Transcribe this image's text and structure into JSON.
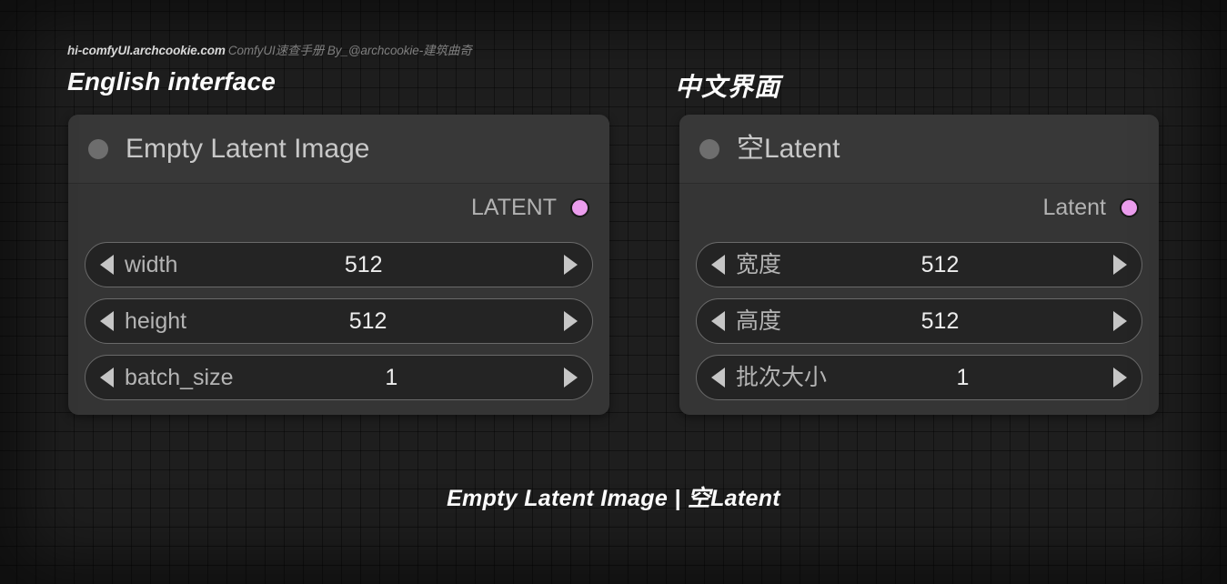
{
  "header": {
    "site": "hi-comfyUI.archcookie.com",
    "subtitle": "ComfyUI速查手册  By_@archcookie-建筑曲奇"
  },
  "sections": {
    "english_title": "English interface",
    "chinese_title": "中文界面"
  },
  "colors": {
    "latent_dot": "#eb9ded",
    "node_body": "#353535",
    "node_header": "#383838",
    "widget_fill": "#242424",
    "widget_border": "#6a6a6a"
  },
  "nodes": [
    {
      "id": "empty-latent-image-en",
      "title": "Empty Latent Image",
      "collapse_icon": "collapse-dot-icon",
      "output": {
        "label": "LATENT",
        "dot_icon": "latent-output-dot-icon"
      },
      "widgets": [
        {
          "name": "width",
          "label": "width",
          "value": "512"
        },
        {
          "name": "height",
          "label": "height",
          "value": "512"
        },
        {
          "name": "batch_size",
          "label": "batch_size",
          "value": "1"
        }
      ]
    },
    {
      "id": "empty-latent-image-zh",
      "title": "空Latent",
      "collapse_icon": "collapse-dot-icon",
      "output": {
        "label": "Latent",
        "dot_icon": "latent-output-dot-icon"
      },
      "widgets": [
        {
          "name": "width",
          "label": "宽度",
          "value": "512"
        },
        {
          "name": "height",
          "label": "高度",
          "value": "512"
        },
        {
          "name": "batch_size",
          "label": "批次大小",
          "value": "1"
        }
      ]
    }
  ],
  "caption": "Empty Latent Image | 空Latent"
}
